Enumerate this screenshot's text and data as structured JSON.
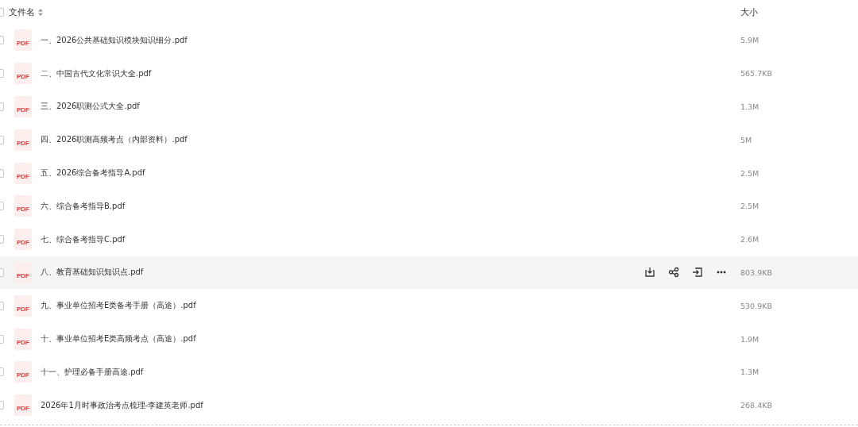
{
  "header": {
    "checked": false,
    "name_label": "文件名",
    "size_label": "大小"
  },
  "rows": [
    {
      "name": "一、2026公共基础知识模块知识细分.pdf",
      "icon_label": "PDF",
      "size": "5.9M",
      "checked": false,
      "hovered": false
    },
    {
      "name": "二、中国古代文化常识大全.pdf",
      "icon_label": "PDF",
      "size": "565.7KB",
      "checked": false,
      "hovered": false
    },
    {
      "name": "三、2026职测公式大全.pdf",
      "icon_label": "PDF",
      "size": "1.3M",
      "checked": false,
      "hovered": false
    },
    {
      "name": "四、2026职测高频考点（内部资料）.pdf",
      "icon_label": "PDF",
      "size": "5M",
      "checked": false,
      "hovered": false
    },
    {
      "name": "五、2026综合备考指导A.pdf",
      "icon_label": "PDF",
      "size": "2.5M",
      "checked": false,
      "hovered": false
    },
    {
      "name": "六、综合备考指导B.pdf",
      "icon_label": "PDF",
      "size": "2.5M",
      "checked": false,
      "hovered": false
    },
    {
      "name": "七、综合备考指导C.pdf",
      "icon_label": "PDF",
      "size": "2.6M",
      "checked": false,
      "hovered": false
    },
    {
      "name": "八、教育基础知识知识点.pdf",
      "icon_label": "PDF",
      "size": "803.9KB",
      "checked": false,
      "hovered": true
    },
    {
      "name": "九、事业单位招考E类备考手册（高途）.pdf",
      "icon_label": "PDF",
      "size": "530.9KB",
      "checked": false,
      "hovered": false
    },
    {
      "name": "十、事业单位招考E类高频考点（高途）.pdf",
      "icon_label": "PDF",
      "size": "1.9M",
      "checked": false,
      "hovered": false
    },
    {
      "name": "十一、护理必备手册高途.pdf",
      "icon_label": "PDF",
      "size": "1.3M",
      "checked": false,
      "hovered": false
    },
    {
      "name": "2026年1月时事政治考点梳理-李建英老师.pdf",
      "icon_label": "PDF",
      "size": "268.4KB",
      "checked": false,
      "hovered": false
    }
  ]
}
